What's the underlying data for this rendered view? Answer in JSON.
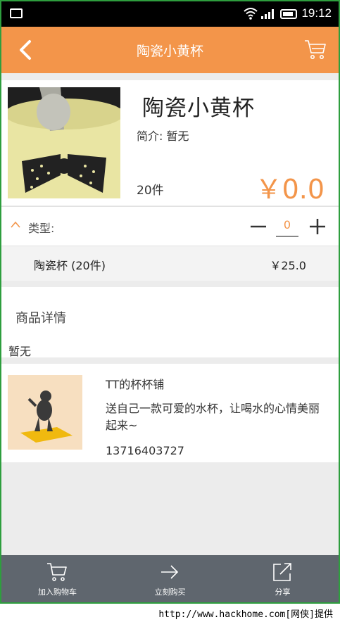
{
  "status_bar": {
    "time": "19:12"
  },
  "header": {
    "title": "陶瓷小黄杯"
  },
  "product": {
    "name": "陶瓷小黄杯",
    "description": "简介: 暂无",
    "stock": "20件",
    "price": "￥0.0"
  },
  "type_selector": {
    "label": "类型:",
    "quantity": "0"
  },
  "variant": {
    "name": "陶瓷杯 (20件)",
    "price": "￥25.0"
  },
  "details": {
    "title": "商品详情",
    "text": "暂无"
  },
  "shop": {
    "name": "TT的杯杯铺",
    "description": "送自己一款可爱的水杯，让喝水的心情美丽起来~",
    "phone": "13716403727"
  },
  "bottom_bar": {
    "add_to_cart": "加入购物车",
    "buy_now": "立刻购买",
    "share": "分享"
  },
  "watermark": "http://www.hackhome.com[网侠]提供",
  "colors": {
    "accent": "#f3954a",
    "bottom_bar": "#5f666e",
    "frame": "#2e9e3e"
  }
}
